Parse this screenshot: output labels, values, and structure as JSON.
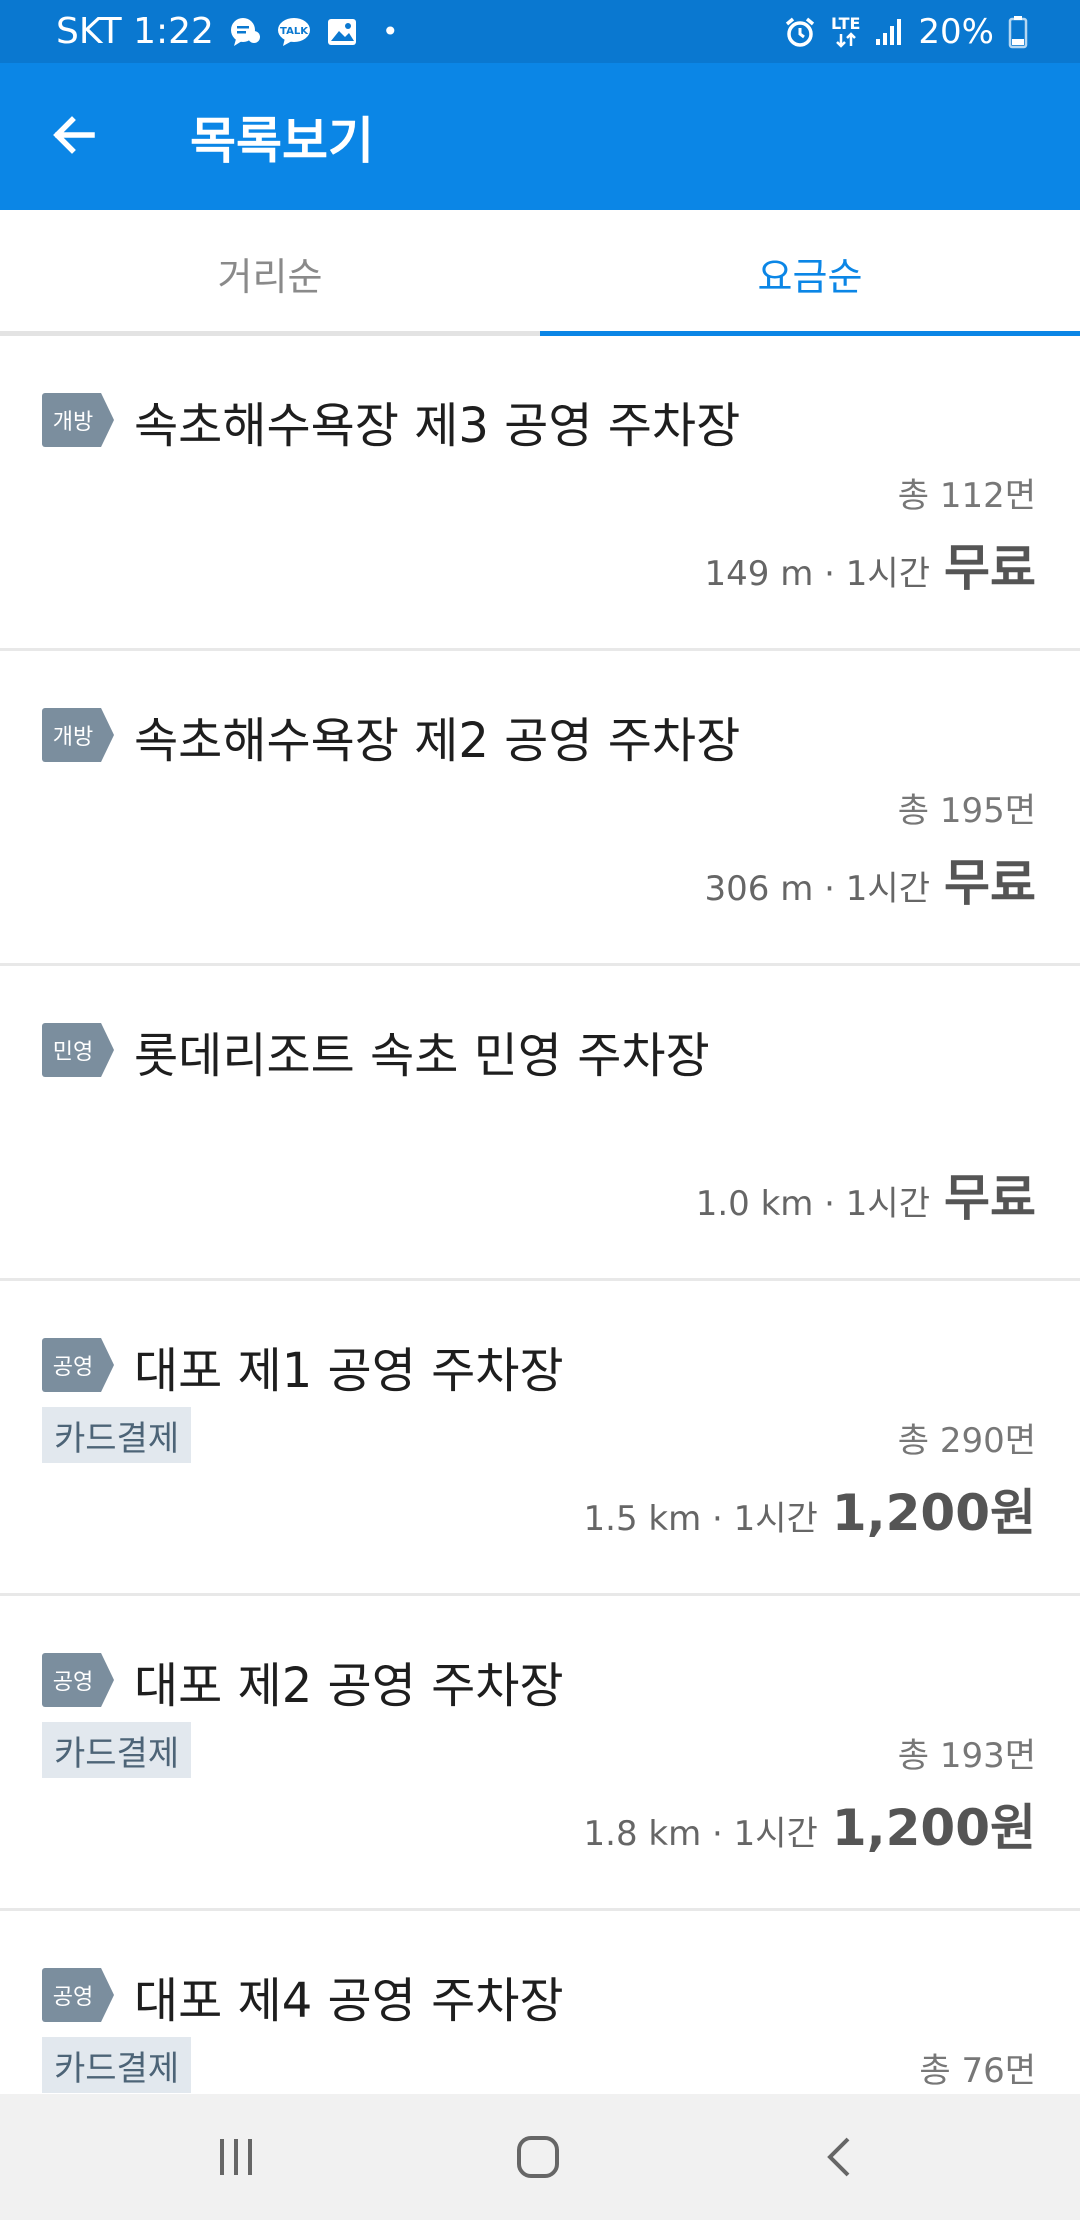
{
  "status_bar": {
    "carrier_time": "SKT 1:22",
    "dot": "•",
    "network": "LTE",
    "battery": "20%",
    "icons": [
      "chat-bubbles-icon",
      "talk-icon",
      "image-icon",
      "alarm-icon",
      "lte-icon",
      "signal-icon",
      "battery-icon"
    ]
  },
  "app_bar": {
    "title": "목록보기",
    "back_icon": "arrow-left-icon"
  },
  "tabs": [
    {
      "label": "거리순",
      "active": false
    },
    {
      "label": "요금순",
      "active": true
    }
  ],
  "colors": {
    "status_bar": "#0a78d0",
    "app_bar": "#0b86e6",
    "active_tab": "#0b86e6",
    "badge": "#7b8e9e",
    "card_tag_bg": "#e2e8ee"
  },
  "items": [
    {
      "badge": "개방",
      "name": "속초해수욕장 제3 공영 주차장",
      "card_tag": "",
      "capacity": "총 112면",
      "dist_time": "149 m · 1시간",
      "price": "무료"
    },
    {
      "badge": "개방",
      "name": "속초해수욕장 제2 공영 주차장",
      "card_tag": "",
      "capacity": "총 195면",
      "dist_time": "306 m · 1시간",
      "price": "무료"
    },
    {
      "badge": "민영",
      "name": "롯데리조트 속초 민영 주차장",
      "card_tag": "",
      "capacity": "",
      "dist_time": "1.0 km · 1시간",
      "price": "무료"
    },
    {
      "badge": "공영",
      "name": "대포 제1 공영 주차장",
      "card_tag": "카드결제",
      "capacity": "총 290면",
      "dist_time": "1.5 km · 1시간",
      "price": "1,200원"
    },
    {
      "badge": "공영",
      "name": "대포 제2 공영 주차장",
      "card_tag": "카드결제",
      "capacity": "총 193면",
      "dist_time": "1.8 km · 1시간",
      "price": "1,200원"
    },
    {
      "badge": "공영",
      "name": "대포 제4 공영 주차장",
      "card_tag": "카드결제",
      "capacity": "총 76면",
      "dist_time": "",
      "price": ""
    }
  ],
  "nav_bar": {
    "icons": [
      "recent-apps-icon",
      "home-icon",
      "back-icon"
    ]
  }
}
